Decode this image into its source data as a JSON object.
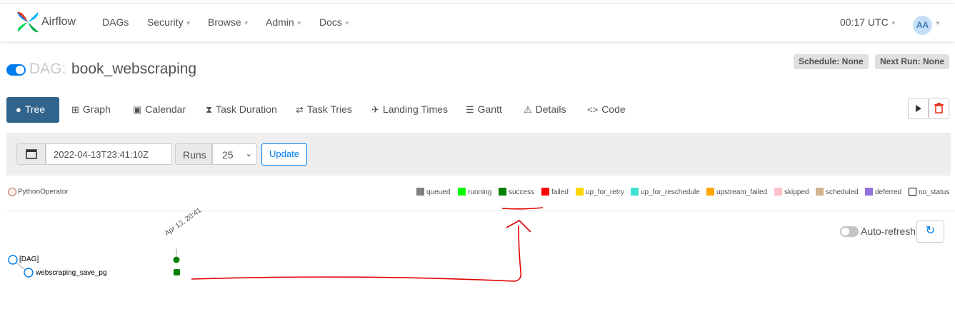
{
  "nav": {
    "brand": "Airflow",
    "items": [
      {
        "label": "DAGs",
        "dropdown": false
      },
      {
        "label": "Security",
        "dropdown": true
      },
      {
        "label": "Browse",
        "dropdown": true
      },
      {
        "label": "Admin",
        "dropdown": true
      },
      {
        "label": "Docs",
        "dropdown": true
      }
    ],
    "clock": "00:17 UTC",
    "avatar_initials": "AA"
  },
  "dag": {
    "prefix": "DAG:",
    "id": "book_webscraping",
    "paused": false,
    "schedule": "Schedule: None",
    "next_run": "Next Run: None"
  },
  "tabs": [
    {
      "label": "Tree",
      "icon": "tree-icon",
      "active": true
    },
    {
      "label": "Graph",
      "icon": "graph-icon",
      "active": false
    },
    {
      "label": "Calendar",
      "icon": "calendar-icon",
      "active": false
    },
    {
      "label": "Task Duration",
      "icon": "hourglass-icon",
      "active": false
    },
    {
      "label": "Task Tries",
      "icon": "retry-icon",
      "active": false
    },
    {
      "label": "Landing Times",
      "icon": "landing-icon",
      "active": false
    },
    {
      "label": "Gantt",
      "icon": "gantt-icon",
      "active": false
    },
    {
      "label": "Details",
      "icon": "warning-icon",
      "active": false
    },
    {
      "label": "Code",
      "icon": "code-icon",
      "active": false
    }
  ],
  "form": {
    "base_date": "2022-04-13T23:41:10Z",
    "runs_label": "Runs",
    "runs_value": "25",
    "update_label": "Update"
  },
  "legend": {
    "operator": "PythonOperator",
    "states": [
      {
        "label": "queued",
        "color": "#808080"
      },
      {
        "label": "running",
        "color": "#00ff00"
      },
      {
        "label": "success",
        "color": "#008000"
      },
      {
        "label": "failed",
        "color": "#ff0000"
      },
      {
        "label": "up_for_retry",
        "color": "#ffd700"
      },
      {
        "label": "up_for_reschedule",
        "color": "#40e0d0"
      },
      {
        "label": "upstream_failed",
        "color": "#ffa500"
      },
      {
        "label": "skipped",
        "color": "#ffc0cb"
      },
      {
        "label": "scheduled",
        "color": "#d2b48c"
      },
      {
        "label": "deferred",
        "color": "#9370db"
      },
      {
        "label": "no_status",
        "color": "#ffffff"
      }
    ]
  },
  "tree": {
    "auto_refresh_label": "Auto-refresh",
    "run_date_label": "Apr 13, 20:41",
    "root_label": "[DAG]",
    "task_label": "webscraping_save_pg",
    "run_state": "success",
    "task_state": "success"
  },
  "colors": {
    "primary": "#017cee",
    "active_tab": "#31648c",
    "annotation": "#e00000"
  }
}
